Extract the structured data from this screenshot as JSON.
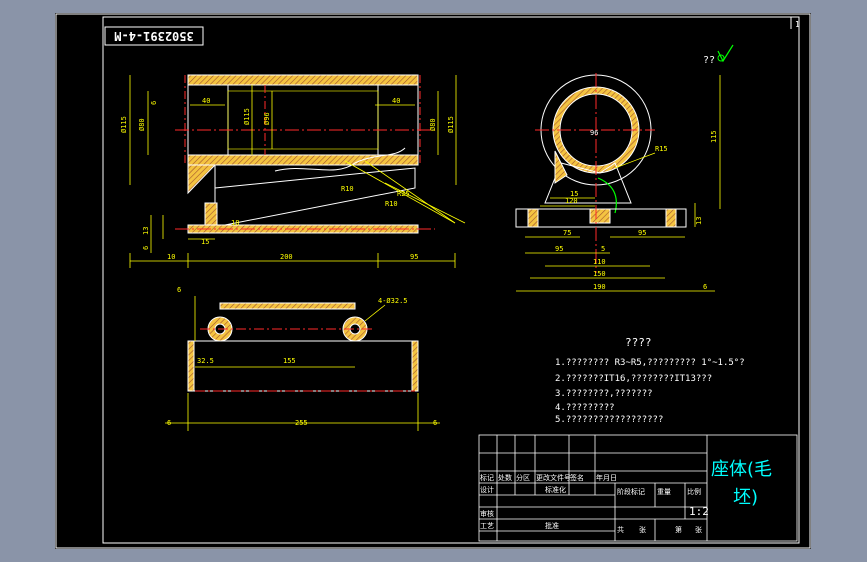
{
  "drawing": {
    "number_rotated": "3502391-4-M",
    "page_mark": "1",
    "roughness_mark": "??",
    "title_main": "座体(毛",
    "title_sub": "坯)",
    "scale": "1:2",
    "notes_heading": "????",
    "notes": [
      "1.???????? R3~R5,?????????  1°~1.5°?",
      "2.???????IT16,????????IT13???",
      "3.????????,???????",
      "4.?????????",
      "5.??????????????????"
    ]
  },
  "front_view": {
    "dims": {
      "d15": "Ø115",
      "d80": "Ø80",
      "w40_left": "40",
      "w40_right": "40",
      "inner_d15": "Ø115",
      "inner_d96": "Ø96",
      "r_d80": "Ø80",
      "r_d115": "Ø115",
      "h6": "6",
      "h13": "13",
      "h18": "18",
      "h15": "15",
      "h6b": "6",
      "l10": "10",
      "l200": "200",
      "l95": "95",
      "r10a": "R10",
      "r25": "R25",
      "r10b": "R10"
    }
  },
  "side_view": {
    "dims": {
      "center": "96",
      "r15": "R15",
      "h115": "115",
      "w15": "15",
      "w120": "120",
      "h13": "13",
      "w75": "75",
      "w95": "95",
      "w95b": "95",
      "w5": "5",
      "w110": "110",
      "w150": "150",
      "w190": "190",
      "w6": "6"
    }
  },
  "top_view": {
    "dims": {
      "t6": "6",
      "holes": "4-Ø32.5",
      "w32_5": "32.5",
      "w155": "155",
      "b6l": "6",
      "w255": "255",
      "b6r": "6"
    }
  },
  "title_block": {
    "row_labels": [
      "标记",
      "处数",
      "分区",
      "更改文件号",
      "签名",
      "年月日"
    ],
    "designer": "设计",
    "standardize": "标准化",
    "stage": "阶段标记",
    "weight": "重量",
    "scale_label": "比例",
    "review": "审核",
    "process": "工艺",
    "approve": "批准",
    "total": "共",
    "sheets": "张",
    "sheet_no": "第",
    "sheet_unit": "张"
  },
  "colors": {
    "background": "#000000",
    "border": "#ffffff",
    "dimension": "#ffff00",
    "centerline": "#ff2a2a",
    "text_cyan": "#00ffff",
    "hatch": "#f4c441",
    "spline": "#00ff00"
  }
}
